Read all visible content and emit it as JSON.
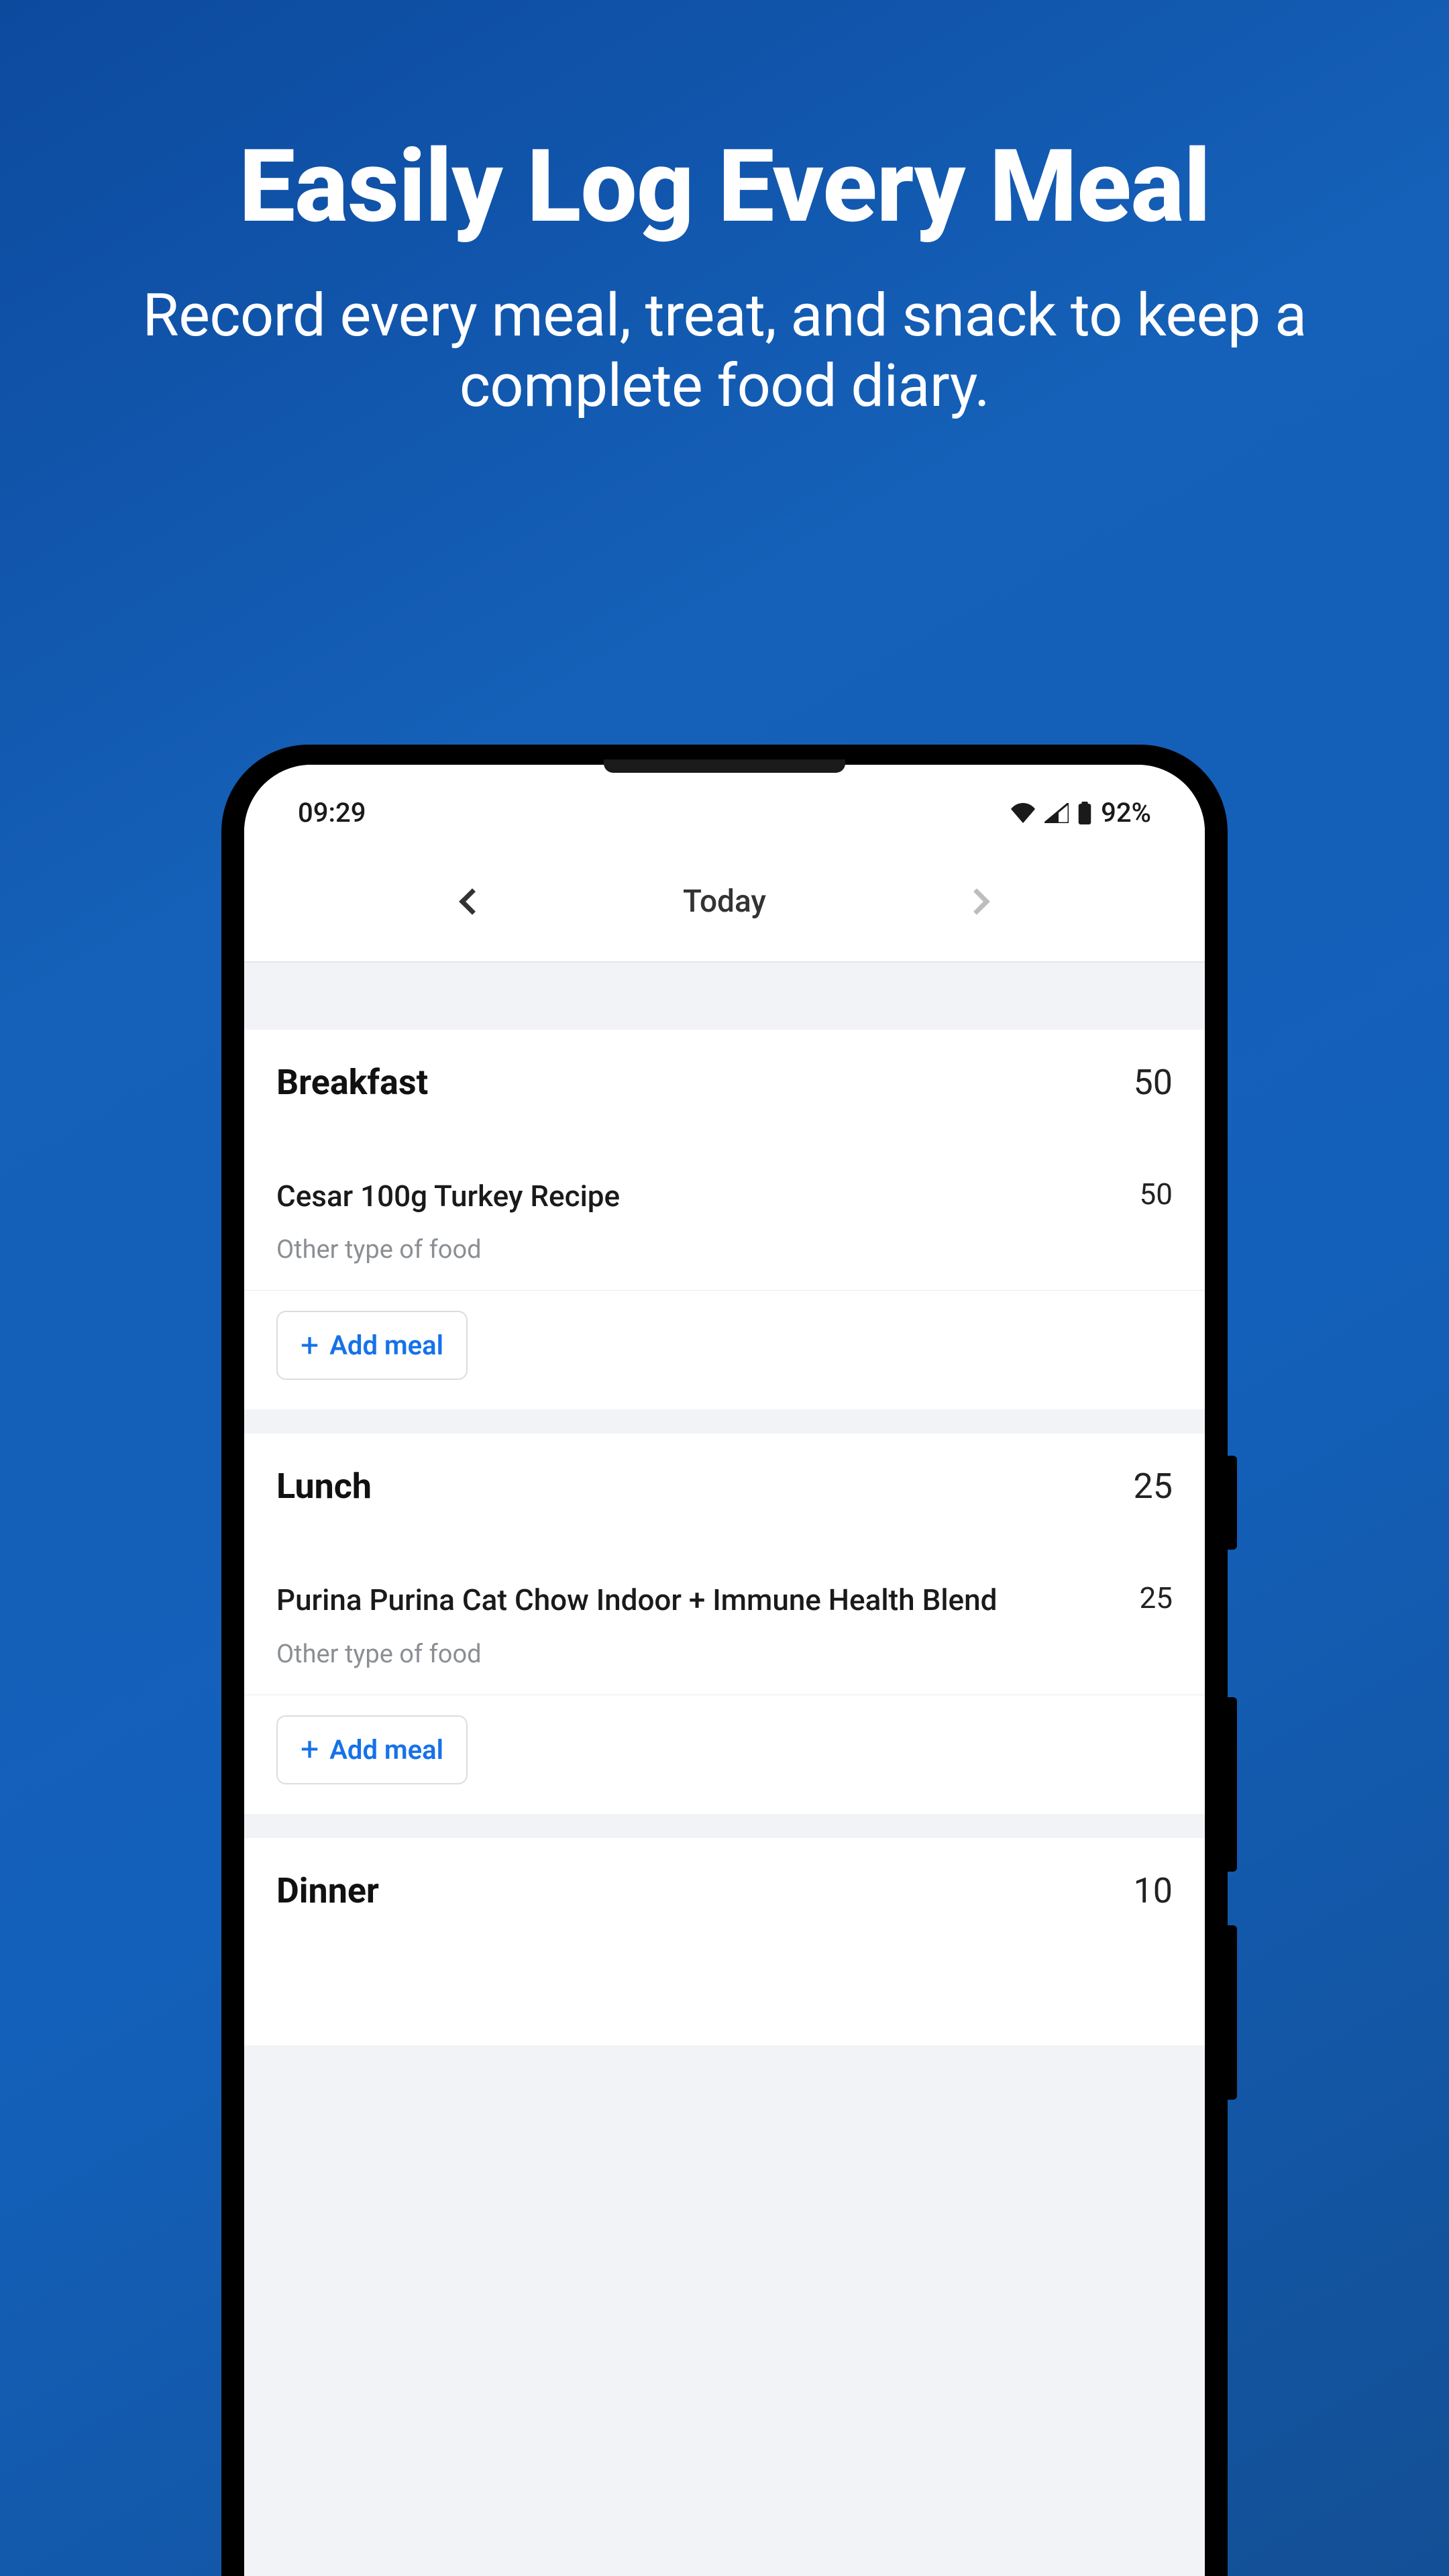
{
  "promo": {
    "title": "Easily Log Every Meal",
    "subtitle": "Record every meal, treat, and snack to keep a complete food diary."
  },
  "status": {
    "time": "09:29",
    "battery": "92%"
  },
  "nav": {
    "title": "Today"
  },
  "ui": {
    "add_meal_label": "Add meal"
  },
  "sections": [
    {
      "title": "Breakfast",
      "total": "50",
      "items": [
        {
          "name": "Cesar 100g Turkey Recipe",
          "subtitle": "Other type of food",
          "value": "50"
        }
      ]
    },
    {
      "title": "Lunch",
      "total": "25",
      "items": [
        {
          "name": "Purina Purina Cat Chow Indoor + Immune Health Blend",
          "subtitle": "Other type of food",
          "value": "25"
        }
      ]
    },
    {
      "title": "Dinner",
      "total": "10",
      "items": []
    }
  ]
}
